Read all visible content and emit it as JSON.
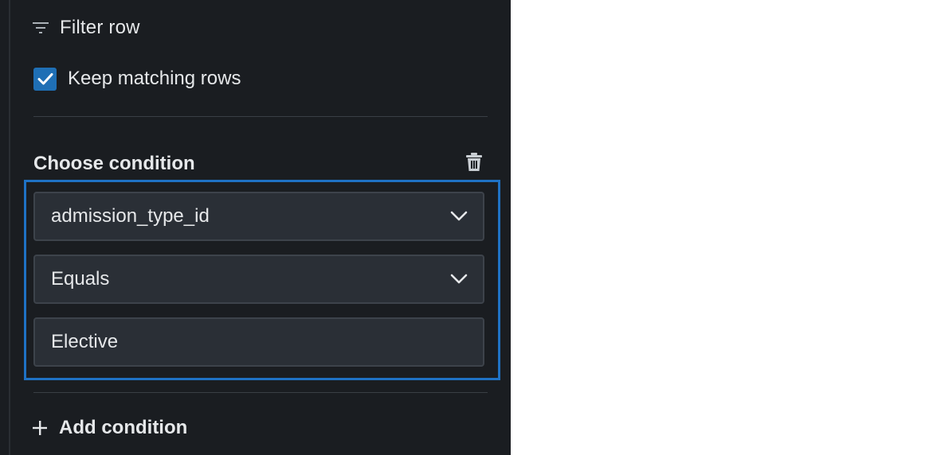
{
  "panel": {
    "title": "Filter row",
    "title_icon": "filter-lines-icon",
    "keep_matching": {
      "label": "Keep matching rows",
      "checked": true
    },
    "condition": {
      "title": "Choose condition",
      "delete_icon": "trash-icon",
      "column_select": {
        "value": "admission_type_id",
        "icon": "chevron-down-icon"
      },
      "operator_select": {
        "value": "Equals",
        "icon": "chevron-down-icon"
      },
      "value_input": {
        "value": "Elective"
      }
    },
    "add_condition": {
      "label": "Add condition",
      "icon": "plus-icon"
    }
  },
  "colors": {
    "panel_bg": "#1a1d21",
    "field_bg": "#2a2f36",
    "accent_blue": "#1f72c4",
    "checkbox_blue": "#1f6fb5",
    "text": "#e6e8ea"
  }
}
